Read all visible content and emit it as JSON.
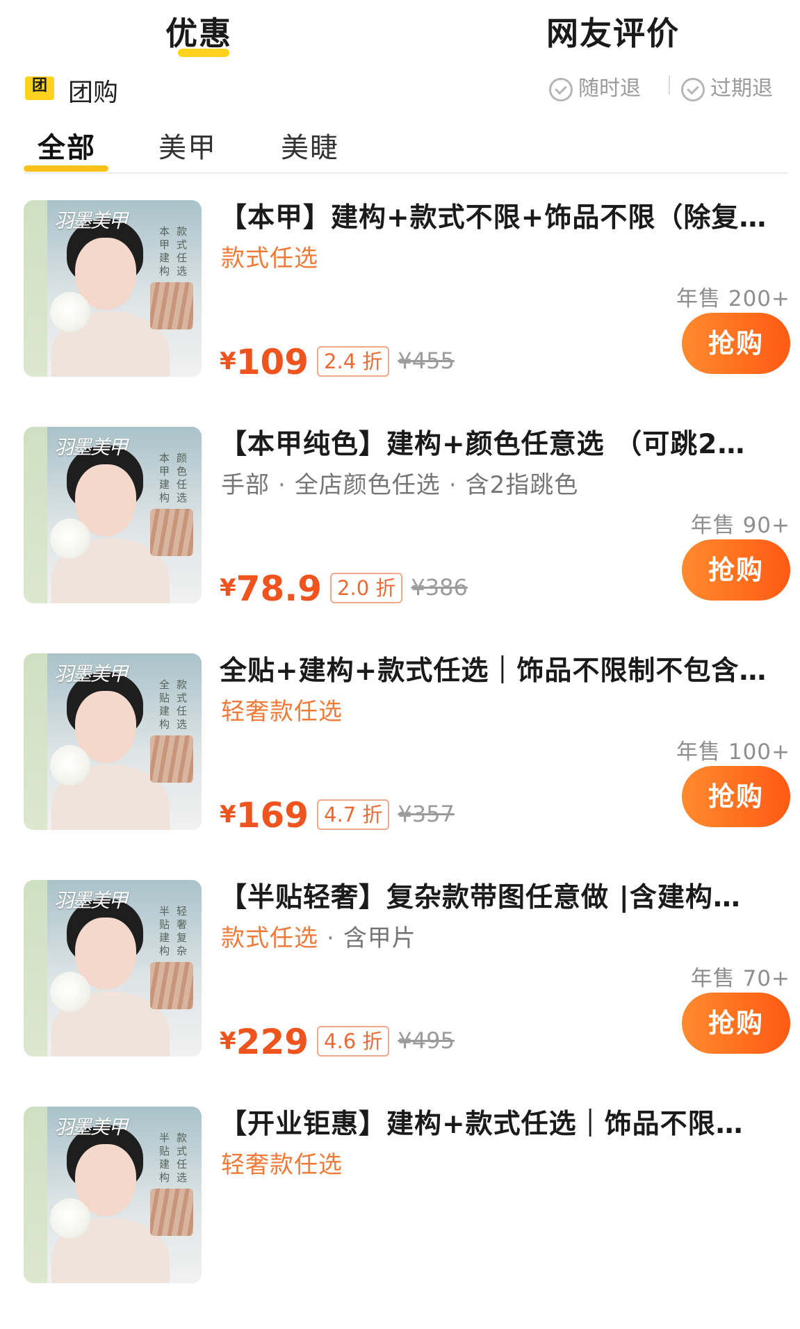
{
  "top_tabs": [
    {
      "label": "优惠",
      "active": true
    },
    {
      "label": "网友评价",
      "active": false
    }
  ],
  "group": {
    "icon_text": "团",
    "label": "团购",
    "guarantees": [
      "随时退",
      "过期退"
    ]
  },
  "category_tabs": [
    {
      "label": "全部",
      "active": true
    },
    {
      "label": "美甲",
      "active": false
    },
    {
      "label": "美睫",
      "active": false
    }
  ],
  "products": [
    {
      "title": "【本甲】建构+款式不限+饰品不限（除复…",
      "tags": [
        {
          "text": "款式任选",
          "accent": true
        }
      ],
      "sales": "年售 200+",
      "price_symbol": "¥",
      "price": "109",
      "discount": "2.4 折",
      "original_price": "¥455",
      "buy_label": "抢购",
      "thumb_brand": "羽墨美甲",
      "thumb_text": [
        "本",
        "甲",
        "建",
        "构",
        "款",
        "式",
        "任",
        "选"
      ]
    },
    {
      "title": "【本甲纯色】建构+颜色任意选 （可跳2…",
      "tags": [
        {
          "text": "手部",
          "accent": false
        },
        {
          "text": "全店颜色任选",
          "accent": false
        },
        {
          "text": "含2指跳色",
          "accent": false
        }
      ],
      "sales": "年售 90+",
      "price_symbol": "¥",
      "price": "78.9",
      "discount": "2.0 折",
      "original_price": "¥386",
      "buy_label": "抢购",
      "thumb_brand": "羽墨美甲",
      "thumb_text": [
        "本",
        "甲",
        "建",
        "构",
        "颜",
        "色",
        "任",
        "选"
      ]
    },
    {
      "title": "全贴+建构+款式任选｜饰品不限制不包含…",
      "tags": [
        {
          "text": "轻奢款任选",
          "accent": true
        }
      ],
      "sales": "年售 100+",
      "price_symbol": "¥",
      "price": "169",
      "discount": "4.7 折",
      "original_price": "¥357",
      "buy_label": "抢购",
      "thumb_brand": "羽墨美甲",
      "thumb_text": [
        "全",
        "贴",
        "建",
        "构",
        "款",
        "式",
        "任",
        "选"
      ]
    },
    {
      "title": "【半贴轻奢】复杂款带图任意做 |含建构…",
      "tags": [
        {
          "text": "款式任选",
          "accent": true
        },
        {
          "text": "含甲片",
          "accent": false
        }
      ],
      "sales": "年售 70+",
      "price_symbol": "¥",
      "price": "229",
      "discount": "4.6 折",
      "original_price": "¥495",
      "buy_label": "抢购",
      "thumb_brand": "羽墨美甲",
      "thumb_text": [
        "半",
        "贴",
        "建",
        "构",
        "轻",
        "奢",
        "复",
        "杂"
      ]
    },
    {
      "title": "【开业钜惠】建构+款式任选｜饰品不限…",
      "tags": [
        {
          "text": "轻奢款任选",
          "accent": true
        }
      ],
      "sales": "",
      "price_symbol": "",
      "price": "",
      "discount": "",
      "original_price": "",
      "buy_label": "",
      "thumb_brand": "羽墨美甲",
      "thumb_text": [
        "半",
        "贴",
        "建",
        "构",
        "款",
        "式",
        "任",
        "选"
      ]
    }
  ],
  "colors": {
    "accent_orange": "#f0541e",
    "tab_underline": "#ffc21a",
    "buy_button": "#ff6a1a"
  }
}
